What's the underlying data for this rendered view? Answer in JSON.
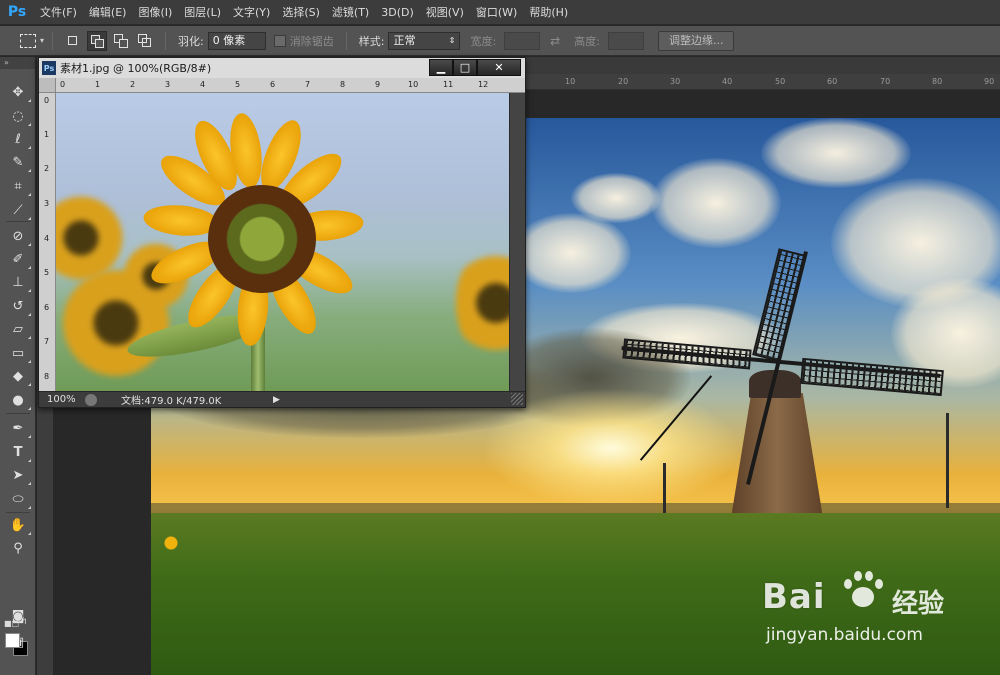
{
  "app": {
    "logo": "Ps"
  },
  "menu": [
    "文件(F)",
    "编辑(E)",
    "图像(I)",
    "图层(L)",
    "文字(Y)",
    "选择(S)",
    "滤镜(T)",
    "3D(D)",
    "视图(V)",
    "窗口(W)",
    "帮助(H)"
  ],
  "options_bar": {
    "feather_label": "羽化:",
    "feather_value": "0 像素",
    "antialias_label": "消除锯齿",
    "style_label": "样式:",
    "style_value": "正常",
    "width_label": "宽度:",
    "height_label": "高度:",
    "refine_edge_button": "调整边缘..."
  },
  "main_ruler": {
    "numbers": [
      "10",
      "20",
      "30",
      "40",
      "50",
      "60",
      "70",
      "80",
      "90"
    ]
  },
  "float_window": {
    "icon": "Ps",
    "title": "素材1.jpg @ 100%(RGB/8#)",
    "minimize": "▁",
    "maximize": "□",
    "close": "✕",
    "ruler_top_numbers": [
      "0",
      "1",
      "2",
      "3",
      "4",
      "5",
      "6",
      "7",
      "8",
      "9",
      "10",
      "11",
      "12"
    ],
    "ruler_left_numbers": [
      "0",
      "1",
      "2",
      "3",
      "4",
      "5",
      "6",
      "7",
      "8"
    ],
    "zoom": "100%",
    "doc_info": "文档:479.0 K/479.0K"
  },
  "watermark": {
    "logo_text": "Bai",
    "logo_text_2": "经验",
    "url": "jingyan.baidu.com"
  },
  "colors": {
    "foreground": "#ffffff",
    "background": "#000000",
    "ps_blue": "#31a8ff"
  },
  "toolbox_icons": [
    "move-icon",
    "marquee-icon",
    "lasso-icon",
    "quick-select-icon",
    "crop-icon",
    "eyedropper-icon",
    "healing-brush-icon",
    "brush-icon",
    "clone-stamp-icon",
    "history-brush-icon",
    "eraser-icon",
    "gradient-icon",
    "blur-icon",
    "dodge-icon",
    "pen-icon",
    "type-icon",
    "path-select-icon",
    "ellipse-shape-icon",
    "hand-icon",
    "zoom-icon"
  ]
}
